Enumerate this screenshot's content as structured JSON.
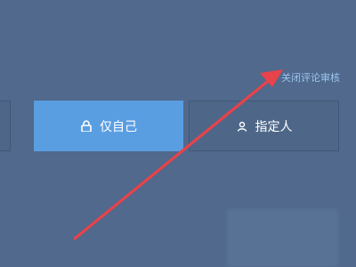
{
  "links": {
    "close_review": "关闭评论审核"
  },
  "options": {
    "only_me": "仅自己",
    "specified": "指定人"
  },
  "icons": {
    "only_me": "lock-icon",
    "specified": "person-icon"
  },
  "colors": {
    "background": "#50698c",
    "selected": "#5a9ee2",
    "link": "#9cc6ee",
    "arrow": "#e8424a"
  }
}
